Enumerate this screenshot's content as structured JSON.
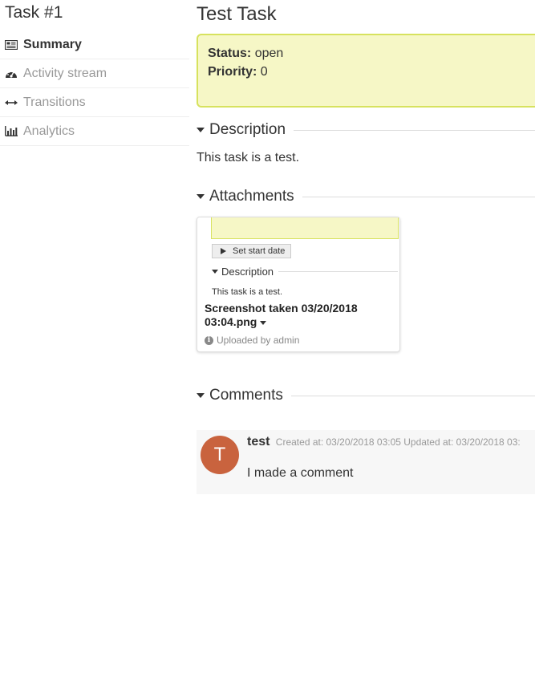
{
  "sidebar": {
    "task_title": "Task #1",
    "items": [
      {
        "label": "Summary",
        "icon": "newspaper-icon",
        "active": true
      },
      {
        "label": "Activity stream",
        "icon": "dashboard-icon",
        "active": false
      },
      {
        "label": "Transitions",
        "icon": "arrows-horizontal-icon",
        "active": false
      },
      {
        "label": "Analytics",
        "icon": "bar-chart-icon",
        "active": false
      }
    ]
  },
  "main": {
    "title": "Test Task",
    "status": {
      "status_label": "Status:",
      "status_value": "open",
      "priority_label": "Priority:",
      "priority_value": "0"
    },
    "description": {
      "heading": "Description",
      "text": "This task is a test."
    },
    "attachments": {
      "heading": "Attachments",
      "items": [
        {
          "thumbnail": {
            "button_label": "Set start date",
            "description_heading": "Description",
            "description_text": "This task is a test."
          },
          "file_name": "Screenshot taken 03/20/2018 03:04.png",
          "uploaded_by": "Uploaded by admin"
        }
      ]
    },
    "comments": {
      "heading": "Comments",
      "items": [
        {
          "avatar_letter": "T",
          "author": "test",
          "created": "Created at: 03/20/2018 03:05",
          "updated": "Updated at: 03/20/2018 03:",
          "body": "I made a comment"
        }
      ]
    }
  },
  "colors": {
    "status_bg": "#f6f7c6",
    "status_border": "#d7e25e",
    "avatar_bg": "#c9633e",
    "muted_text": "#999999"
  }
}
